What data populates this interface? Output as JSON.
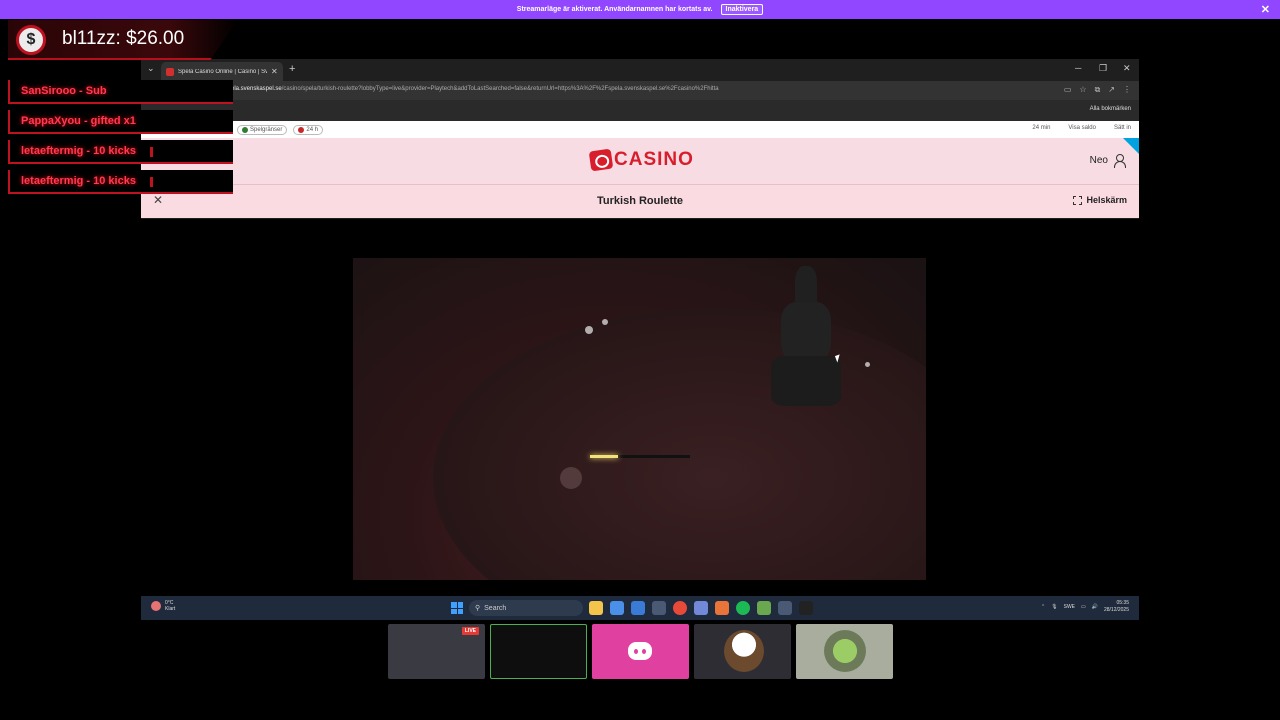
{
  "notice": {
    "text": "Streamarläge är aktiverat. Användarnamnen har kortats av.",
    "button": "Inaktivera",
    "close": "✕"
  },
  "overlay": {
    "donation": "bl11zz: $26.00",
    "events": [
      {
        "label": "SanSirooo - Sub"
      },
      {
        "label": "PappaXyou - gifted x1"
      },
      {
        "label": "letaeftermig - 10 kicks"
      },
      {
        "label": "letaeftermig - 10 kicks"
      }
    ]
  },
  "browser": {
    "tab_title": "Spela Casino Online | Casino | Sv",
    "url_host": "ela.svenskaspel.se",
    "url_path": "/casino/spela/turkish-roulette?lobbyType=live&provider=Playtech&addToLastSearched=false&returnUrl=https%3A%2F%2Fspela.svenskaspel.se%2Fcasino%2Fhitta",
    "bookmarks_all": "Alla bokmärken"
  },
  "casino": {
    "limits_label": "Spelgränser",
    "session_label": "24 h",
    "time_label": "24 min",
    "balance_label": "Visa saldo",
    "deposit_label": "Sätt in",
    "logo_text": "CASINO",
    "user_name": "Neo",
    "game_title": "Turkish Roulette",
    "fullscreen_label": "Helskärm",
    "loading_progress": 0.28
  },
  "taskbar": {
    "temp": "0°C",
    "weather": "Klart",
    "search": "Search",
    "lang": "SWE",
    "time": "05:35",
    "date": "28/12/2025"
  },
  "thumbs": {
    "live_badge": "LIVE"
  },
  "colors": {
    "accent": "#9147ff",
    "brand_red": "#d81e2c",
    "overlay_red": "#c01120"
  }
}
